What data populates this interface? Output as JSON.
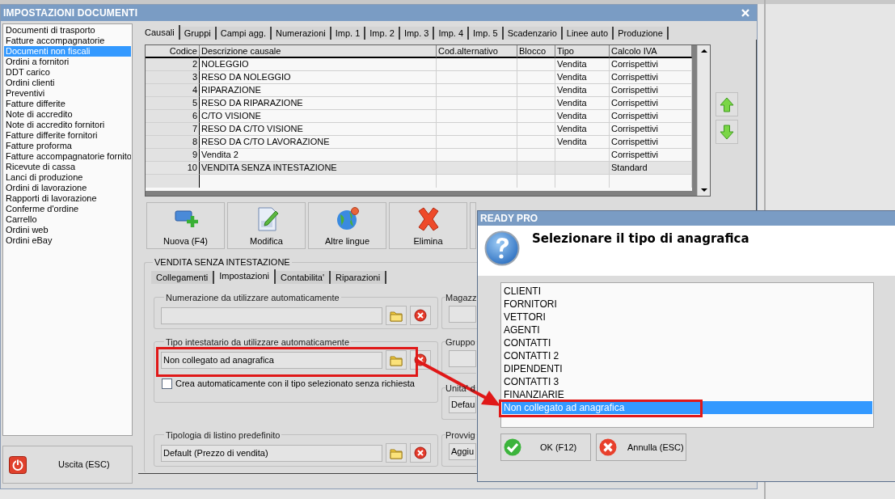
{
  "window": {
    "title": "IMPOSTAZIONI DOCUMENTI"
  },
  "sidebar": {
    "items": [
      {
        "label": "Documenti di trasporto",
        "selected": false
      },
      {
        "label": "Fatture accompagnatorie",
        "selected": false
      },
      {
        "label": "Documenti non fiscali",
        "selected": true
      },
      {
        "label": "Ordini a fornitori",
        "selected": false
      },
      {
        "label": "DDT carico",
        "selected": false
      },
      {
        "label": "Ordini clienti",
        "selected": false
      },
      {
        "label": "Preventivi",
        "selected": false
      },
      {
        "label": "Fatture differite",
        "selected": false
      },
      {
        "label": "Note di accredito",
        "selected": false
      },
      {
        "label": "Note di accredito fornitori",
        "selected": false
      },
      {
        "label": "Fatture differite fornitori",
        "selected": false
      },
      {
        "label": "Fatture proforma",
        "selected": false
      },
      {
        "label": "Fatture accompagnatorie fornito",
        "selected": false
      },
      {
        "label": "Ricevute di cassa",
        "selected": false
      },
      {
        "label": "Lanci di produzione",
        "selected": false
      },
      {
        "label": "Ordini di lavorazione",
        "selected": false
      },
      {
        "label": "Rapporti di lavorazione",
        "selected": false
      },
      {
        "label": "Conferme d'ordine",
        "selected": false
      },
      {
        "label": "Carrello",
        "selected": false
      },
      {
        "label": "Ordini web",
        "selected": false
      },
      {
        "label": "Ordini eBay",
        "selected": false
      }
    ]
  },
  "exit_button": {
    "label": "Uscita (ESC)"
  },
  "tabs": [
    {
      "label": "Causali",
      "selected": true
    },
    {
      "label": "Gruppi",
      "selected": false
    },
    {
      "label": "Campi agg.",
      "selected": false
    },
    {
      "label": "Numerazioni",
      "selected": false
    },
    {
      "label": "Imp. 1",
      "selected": false
    },
    {
      "label": "Imp. 2",
      "selected": false
    },
    {
      "label": "Imp. 3",
      "selected": false
    },
    {
      "label": "Imp. 4",
      "selected": false
    },
    {
      "label": "Imp. 5",
      "selected": false
    },
    {
      "label": "Scadenzario",
      "selected": false
    },
    {
      "label": "Linee auto",
      "selected": false
    },
    {
      "label": "Produzione",
      "selected": false
    }
  ],
  "table": {
    "columns": [
      "Codice",
      "Descrizione causale",
      "Cod.alternativo",
      "Blocco",
      "Tipo",
      "Calcolo IVA"
    ],
    "rows": [
      {
        "cells": [
          "2",
          "NOLEGGIO",
          null,
          null,
          "Vendita",
          "Corrispettivi"
        ],
        "selected": false
      },
      {
        "cells": [
          "3",
          "RESO DA NOLEGGIO",
          null,
          null,
          "Vendita",
          "Corrispettivi"
        ],
        "selected": false
      },
      {
        "cells": [
          "4",
          "RIPARAZIONE",
          null,
          null,
          "Vendita",
          "Corrispettivi"
        ],
        "selected": false
      },
      {
        "cells": [
          "5",
          "RESO DA RIPARAZIONE",
          null,
          null,
          "Vendita",
          "Corrispettivi"
        ],
        "selected": false
      },
      {
        "cells": [
          "6",
          "C/TO VISIONE",
          null,
          null,
          "Vendita",
          "Corrispettivi"
        ],
        "selected": false
      },
      {
        "cells": [
          "7",
          "RESO DA C/TO VISIONE",
          null,
          null,
          "Vendita",
          "Corrispettivi"
        ],
        "selected": false
      },
      {
        "cells": [
          "8",
          "RESO DA C/TO LAVORAZIONE",
          null,
          null,
          "Vendita",
          "Corrispettivi"
        ],
        "selected": false
      },
      {
        "cells": [
          "9",
          "Vendita 2",
          null,
          null,
          null,
          "Corrispettivi"
        ],
        "selected": false
      },
      {
        "cells": [
          "10",
          "VENDITA SENZA INTESTAZIONE",
          null,
          null,
          null,
          "Standard"
        ],
        "selected": true
      }
    ]
  },
  "toolbar": [
    {
      "label": "Nuova (F4)",
      "kind": "add"
    },
    {
      "label": "Modifica",
      "kind": "edit"
    },
    {
      "label": "Altre lingue",
      "kind": "globe"
    },
    {
      "label": "Elimina",
      "kind": "delete"
    },
    {
      "kind": "blank"
    }
  ],
  "detail": {
    "title": "VENDITA SENZA INTESTAZIONE",
    "tabs": [
      {
        "label": "Collegamenti",
        "selected": false
      },
      {
        "label": "Impostazioni",
        "selected": true
      },
      {
        "label": "Contabilita'",
        "selected": false
      },
      {
        "label": "Riparazioni",
        "selected": false
      }
    ],
    "groups": [
      {
        "title": "Numerazione da utilizzare automaticamente"
      },
      {
        "title": "Tipo intestatario da utilizzare automaticamente",
        "value": "Non collegato ad anagrafica",
        "highlighted": true,
        "checkbox": {
          "label": "Crea automaticamente con il tipo selezionato senza richiesta",
          "checked": false
        }
      },
      {
        "title": "Tipologia di listino predefinito",
        "value": "Default (Prezzo di vendita)"
      }
    ],
    "side_groups": [
      {
        "title": "Magazz"
      },
      {
        "title": "Gruppo"
      },
      {
        "title": "Unita' d",
        "value": "Defau"
      },
      {
        "title": "Provvig",
        "value": "Aggiu"
      }
    ]
  },
  "dialog": {
    "title": "READY PRO",
    "heading": "Selezionare il tipo di anagrafica",
    "items": [
      {
        "label": "CLIENTI",
        "selected": false
      },
      {
        "label": "FORNITORI",
        "selected": false
      },
      {
        "label": "VETTORI",
        "selected": false
      },
      {
        "label": "AGENTI",
        "selected": false
      },
      {
        "label": "CONTATTI",
        "selected": false
      },
      {
        "label": "CONTATTI 2",
        "selected": false
      },
      {
        "label": "DIPENDENTI",
        "selected": false
      },
      {
        "label": "CONTATTI 3",
        "selected": false
      },
      {
        "label": "FINANZIARIE",
        "selected": false
      },
      {
        "label": "Non collegato ad anagrafica",
        "selected": true
      }
    ],
    "buttons": [
      {
        "label": "OK (F12)",
        "kind": "ok"
      },
      {
        "label": "Annulla (ESC)",
        "kind": "cancel"
      }
    ]
  }
}
